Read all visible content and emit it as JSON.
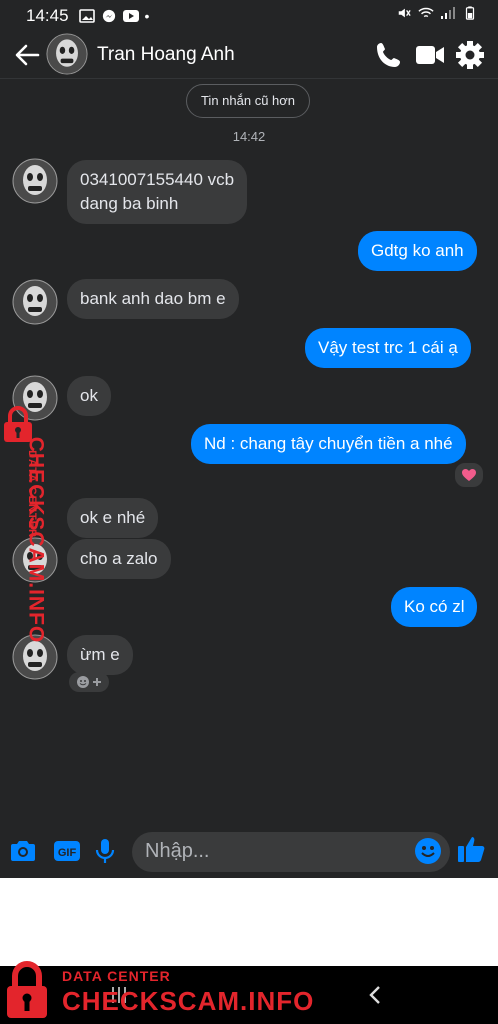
{
  "status_bar": {
    "time": "14:45"
  },
  "header": {
    "contact_name": "Tran Hoang Anh"
  },
  "thread": {
    "older_button": "Tin nhắn cũ hơn",
    "timestamp": "14:42",
    "messages": [
      {
        "dir": "in",
        "text_line1": "0341007155440 vcb",
        "text_line2": "dang ba binh"
      },
      {
        "dir": "out",
        "text": "Gdtg ko anh"
      },
      {
        "dir": "in",
        "text": "bank anh dao bm e"
      },
      {
        "dir": "out",
        "text": "Vậy test trc 1 cái ạ"
      },
      {
        "dir": "in",
        "text": "ok"
      },
      {
        "dir": "out",
        "text": "Nd : chang tây chuyển tiền a nhé",
        "reaction": "heart"
      },
      {
        "dir": "in",
        "text": "ok e nhé"
      },
      {
        "dir": "in",
        "text": "cho a zalo"
      },
      {
        "dir": "out",
        "text": "Ko có zl"
      },
      {
        "dir": "in",
        "text": "ừm e"
      }
    ]
  },
  "composer": {
    "placeholder": "Nhập..."
  },
  "watermark": {
    "small": "DATA CENTER",
    "big": "CHECKSCAM.INFO"
  },
  "colors": {
    "background": "#242526",
    "incoming": "#3a3b3c",
    "outgoing": "#0084ff",
    "watermark": "#e3252c"
  }
}
